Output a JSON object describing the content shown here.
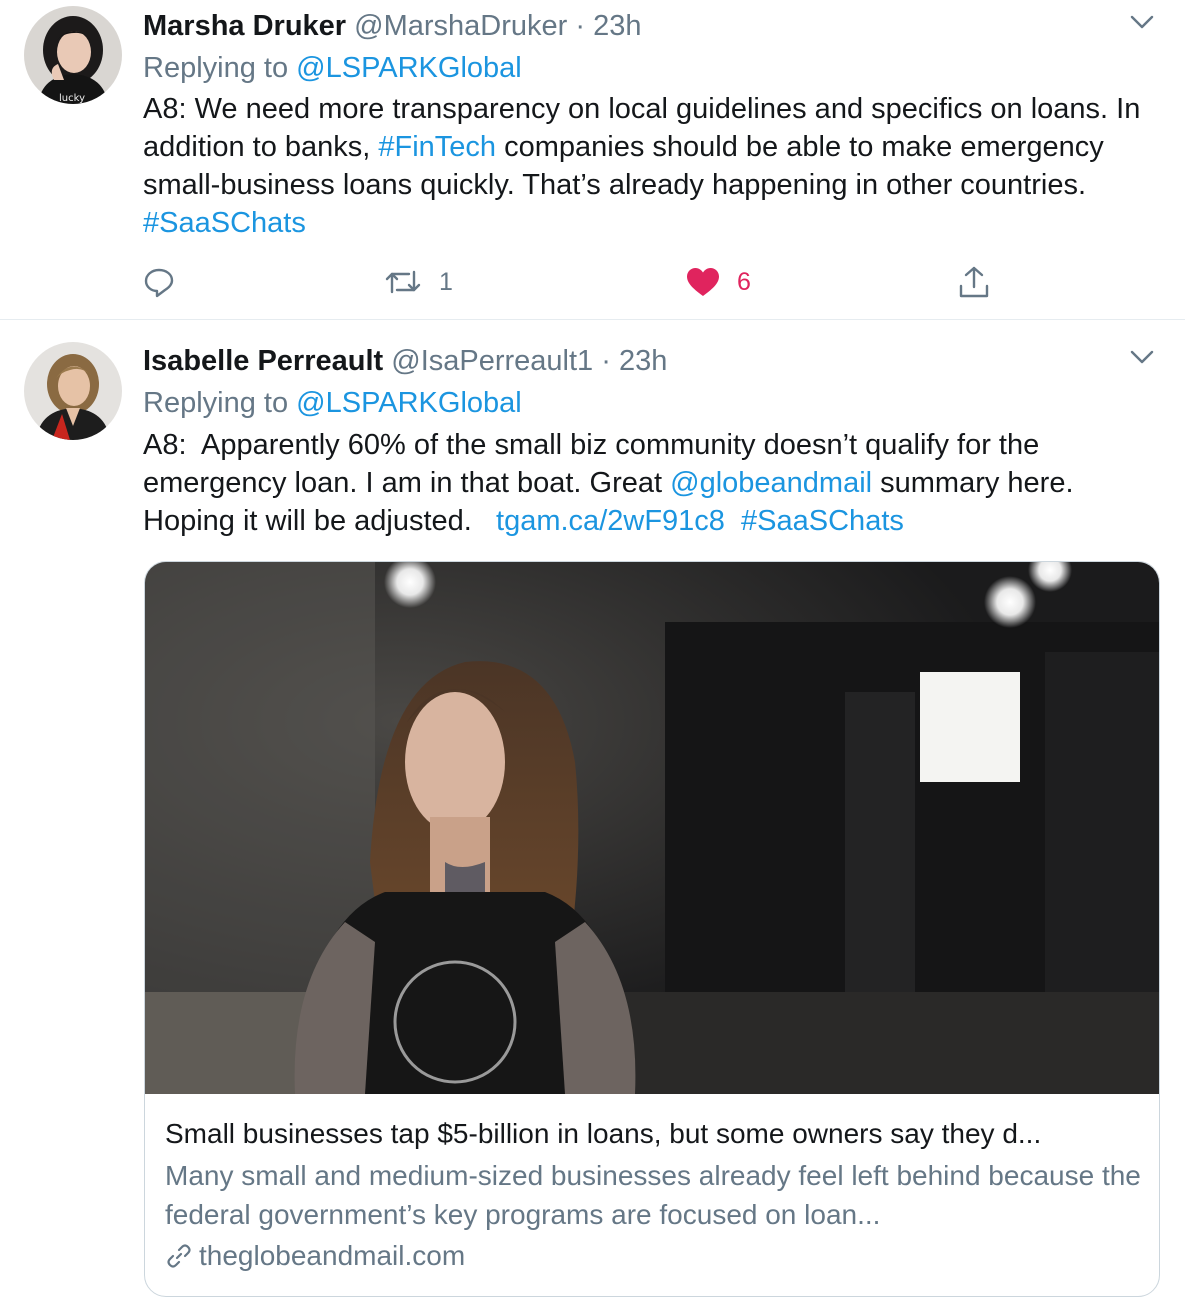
{
  "tweets": [
    {
      "name": "Marsha Druker",
      "handle": "@MarshaDruker",
      "separator": "·",
      "time": "23h",
      "replying_prefix": "Replying to",
      "replying_to": "@LSPARKGlobal",
      "avatar_text": "lucky",
      "text_1": "A8: We need more transparency on local guidelines and specifics on loans. In addition to banks, ",
      "link_1": "#FinTech",
      "text_2": " companies should be able to make emergency small-business loans quickly. That’s already happening in other countries. ",
      "link_2": "#SaaSChats",
      "actions": {
        "reply_count": "",
        "retweet_count": "1",
        "like_count": "6"
      }
    },
    {
      "name": "Isabelle Perreault",
      "handle": "@IsaPerreault1",
      "separator": "·",
      "time": "23h",
      "replying_prefix": "Replying to",
      "replying_to": "@LSPARKGlobal",
      "text_1": "A8:  Apparently 60% of the small biz community doesn’t qualify for the emergency loan. I am in that boat. Great ",
      "link_1": "@globeandmail",
      "text_2": " summary here. Hoping it will be adjusted.   ",
      "link_2": "tgam.ca/2wF91c8",
      "text_3": "  ",
      "link_3": "#SaaSChats",
      "card": {
        "title": "Small businesses tap $5-billion in loans, but some owners say they d...",
        "description": "Many small and medium-sized businesses already feel left behind because the federal government’s key programs are focused on loan...",
        "domain": "theglobeandmail.com"
      }
    }
  ],
  "colors": {
    "link": "#1b95e0",
    "secondary_text": "#657786",
    "like": "#e0245e",
    "divider": "#e6ecf0"
  },
  "icons": {
    "reply": "speech-bubble-icon",
    "retweet": "retweet-arrows-icon",
    "like": "heart-icon",
    "share": "share-upload-icon",
    "caret": "chevron-down-icon",
    "card_link": "link-chain-icon"
  }
}
